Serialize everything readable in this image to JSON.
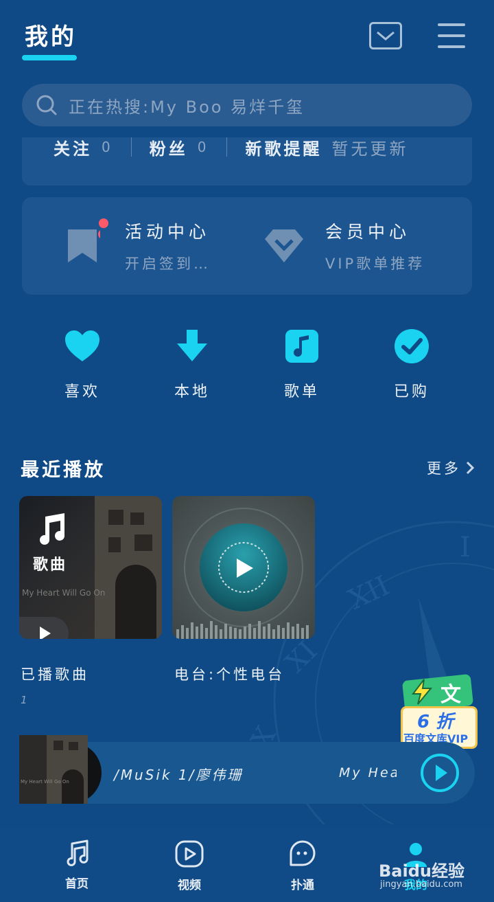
{
  "header": {
    "title": "我的"
  },
  "search": {
    "placeholder": "正在热搜:My Boo 易烊千玺"
  },
  "stats": [
    {
      "label": "关注",
      "value": "0"
    },
    {
      "label": "粉丝",
      "value": "0"
    },
    {
      "label": "新歌提醒",
      "value": "暂无更新"
    }
  ],
  "activity": {
    "left": {
      "title": "活动中心",
      "subtitle": "开启签到…"
    },
    "right": {
      "title": "会员中心",
      "subtitle": "VIP歌单推荐"
    }
  },
  "quick": [
    {
      "label": "喜欢",
      "icon": "heart-icon"
    },
    {
      "label": "本地",
      "icon": "download-icon"
    },
    {
      "label": "歌单",
      "icon": "music-note-icon"
    },
    {
      "label": "已购",
      "icon": "check-circle-icon"
    }
  ],
  "recent": {
    "title": "最近播放",
    "more": "更多",
    "cards": [
      {
        "badge": "歌曲",
        "caption": "已播歌曲",
        "count": "1",
        "overlay_text": "My Heart Will Go On"
      },
      {
        "caption": "电台:个性电台"
      }
    ]
  },
  "player": {
    "info": "/MuSik 1/廖伟珊",
    "song": "My Heart",
    "cover_text": "My Heart Will Go On"
  },
  "ad": {
    "top_glyph": "文",
    "discount": "6 折",
    "brand": "百度文库VIP"
  },
  "bottom_nav": [
    {
      "label": "首页",
      "icon": "music-note-icon"
    },
    {
      "label": "视频",
      "icon": "play-square-icon"
    },
    {
      "label": "扑通",
      "icon": "chat-face-icon"
    },
    {
      "label": "我的",
      "icon": "user-icon"
    }
  ],
  "watermark": {
    "brand": "Baidu经验",
    "url": "jingyan.baidu.com"
  },
  "colors": {
    "background": "#0f4a86",
    "accent": "#19d3f0",
    "card": "#1d5590",
    "muted": "#8ea6c2"
  }
}
